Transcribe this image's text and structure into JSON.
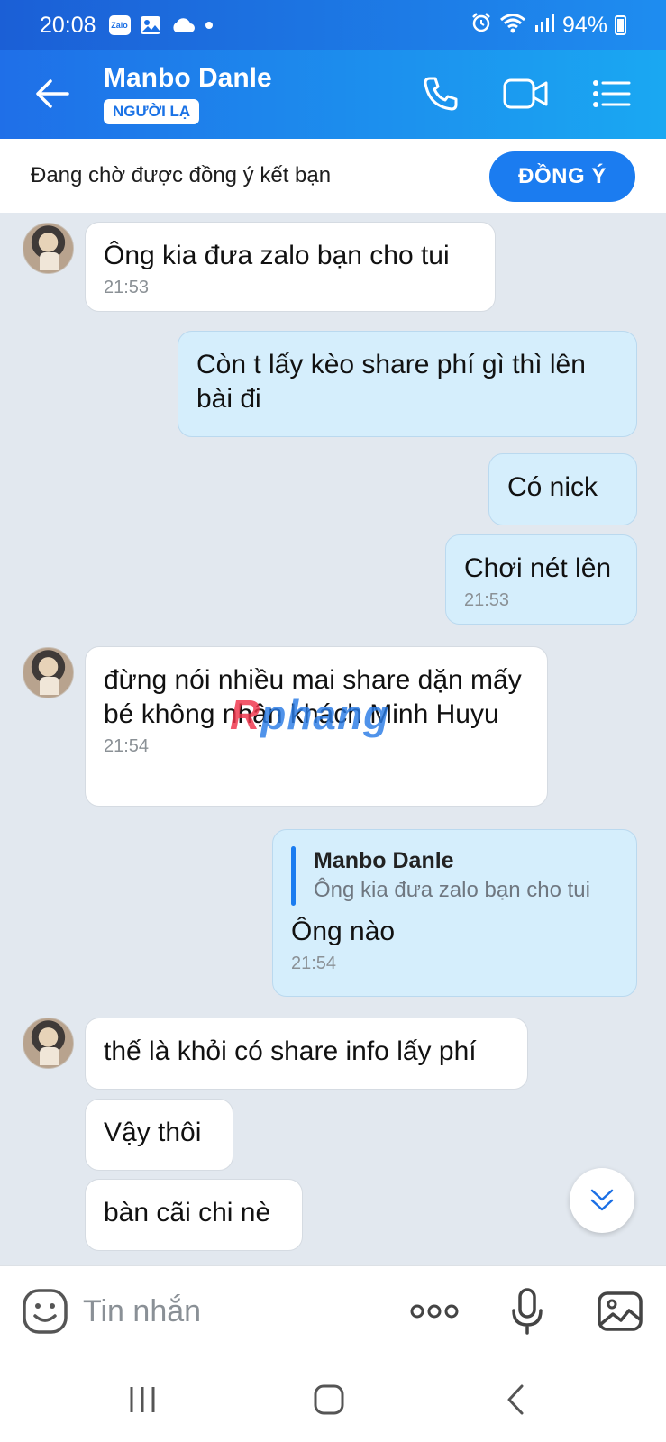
{
  "status_bar": {
    "time": "20:08",
    "zalo_icon_label": "Zalo",
    "battery": "94%"
  },
  "header": {
    "contact_name": "Manbo Danle",
    "badge": "NGƯỜI LẠ",
    "icons": [
      "back-arrow-icon",
      "phone-icon",
      "video-camera-icon",
      "menu-list-icon"
    ]
  },
  "friend_request": {
    "text": "Đang chờ được đồng ý kết bạn",
    "accept_label": "ĐỒNG Ý"
  },
  "messages": [
    {
      "side": "in",
      "text": "Ông kia đưa zalo bạn cho tui",
      "time": "21:53"
    },
    {
      "side": "out",
      "text": "Còn t lấy kèo share phí gì thì lên bài đi",
      "time": ""
    },
    {
      "side": "out",
      "text": "Có nick",
      "time": ""
    },
    {
      "side": "out",
      "text": "Chơi nét lên",
      "time": "21:53"
    },
    {
      "side": "in",
      "text": "đừng nói nhiều mai share dặn mấy bé không nhận khách Minh Huyu",
      "time": "21:54"
    },
    {
      "side": "out",
      "reply_to": {
        "name": "Manbo Danle",
        "text": "Ông kia đưa zalo bạn cho tui"
      },
      "text": "Ông nào",
      "time": "21:54"
    },
    {
      "side": "in",
      "text": "thế là khỏi có share info lấy phí",
      "time": ""
    },
    {
      "side": "in",
      "text": "Vậy thôi",
      "time": ""
    },
    {
      "side": "in",
      "text": "bàn cãi chi nè",
      "time": ""
    }
  ],
  "watermark": {
    "part1": "R",
    "part2": "phang"
  },
  "input": {
    "placeholder": "Tin nhắn"
  },
  "colors": {
    "header_start": "#1f6fe8",
    "header_end": "#1aa8f2",
    "accent": "#1b7cf0",
    "out_bubble": "#d5eefc",
    "chat_bg": "#e2e8ef"
  }
}
